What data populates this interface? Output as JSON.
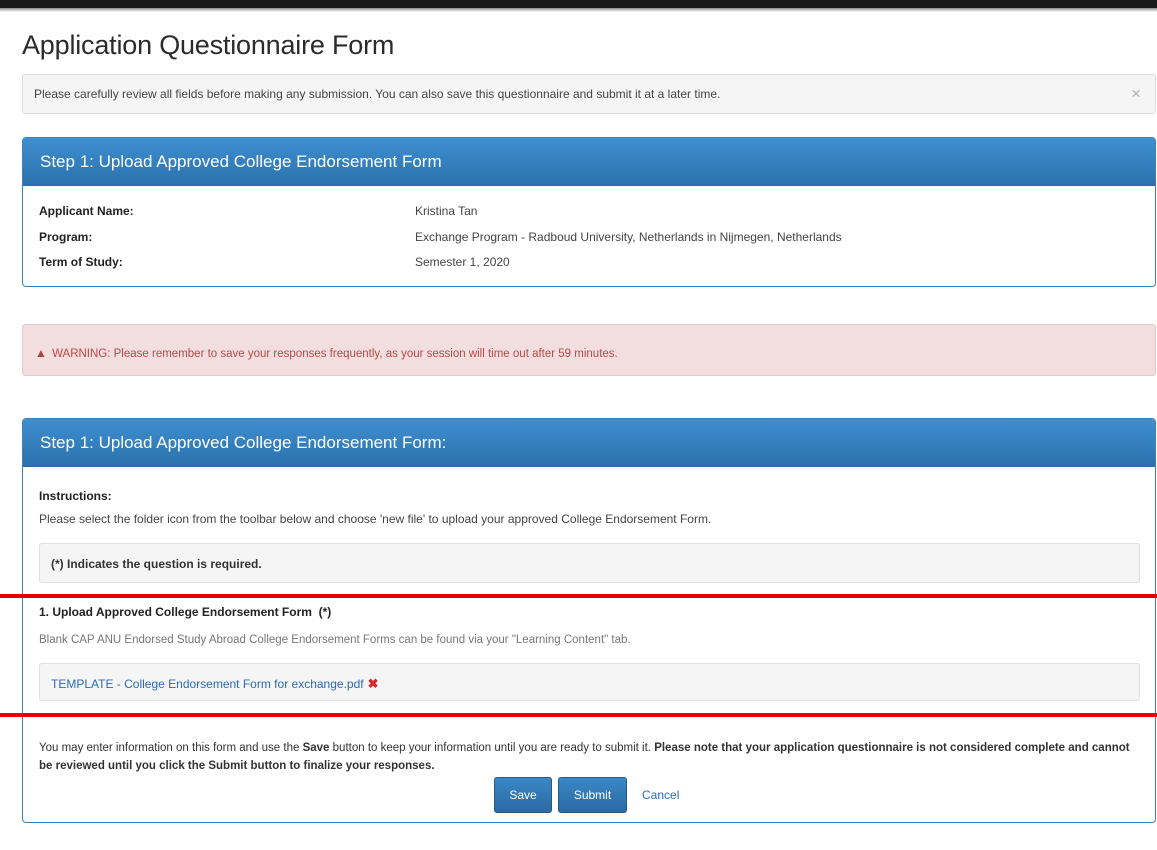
{
  "page": {
    "title": "Application Questionnaire Form"
  },
  "info_alert": {
    "message": "Please carefully review all fields before making any submission. You can also save this questionnaire and submit it at a later time.",
    "close_glyph": "×"
  },
  "step1": {
    "heading": "Step 1: Upload Approved College Endorsement Form",
    "details": [
      {
        "label": "Applicant Name:",
        "value": "Kristina Tan"
      },
      {
        "label": "Program:",
        "value": "Exchange Program - Radboud University, Netherlands in Nijmegen, Netherlands"
      },
      {
        "label": "Term of Study:",
        "value": "Semester 1, 2020"
      }
    ]
  },
  "warning": {
    "icon": "warning-triangle-icon",
    "message": "WARNING: Please remember to save your responses frequently, as your session will time out after 59 minutes."
  },
  "step1_form": {
    "heading": "Step 1: Upload Approved College Endorsement Form:",
    "instructions_label": "Instructions:",
    "instructions_text": "Please select the folder icon from the toolbar below and choose 'new file' to upload your approved College Endorsement Form.",
    "required_note": "(*) Indicates the question is required.",
    "question_title": "1. Upload Approved College Endorsement Form  (*)",
    "question_help": "Blank CAP ANU Endorsed Study Abroad College Endorsement Forms can be found via your \"Learning Content\" tab.",
    "file_name": "TEMPLATE - College Endorsement Form for exchange.pdf",
    "remove_glyph": "✖"
  },
  "footer": {
    "text_1": "You may enter information on this form and use the ",
    "save_word": "Save",
    "text_2": " button to keep your information until you are ready to submit it. ",
    "bold_note": "Please note that your application questionnaire is not considered complete and cannot be reviewed until you click the Submit button to finalize your responses.",
    "save_label": "Save",
    "submit_label": "Submit",
    "cancel_label": "Cancel"
  },
  "colors": {
    "panel_header": "#2f7bbf",
    "warning_bg": "#f2dede",
    "warning_text": "#b94a48",
    "highlight_line": "#e60000",
    "link": "#2a6ab8"
  }
}
